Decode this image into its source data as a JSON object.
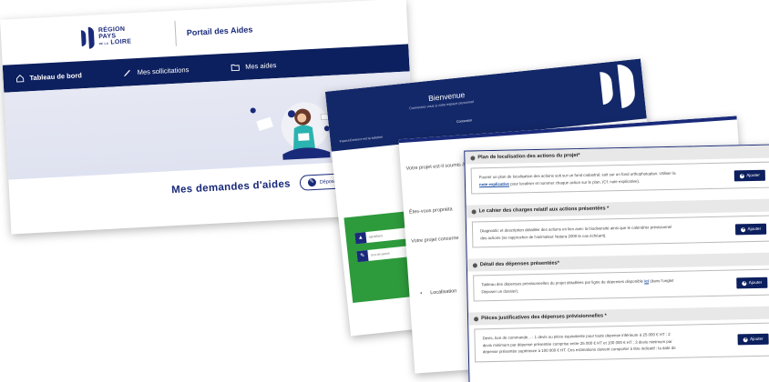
{
  "card1": {
    "logo": {
      "line1": "RÉGION",
      "line2": "PAYS",
      "line3": "LOIRE",
      "small": "DE LA"
    },
    "portal_title": "Portail des Aides",
    "nav": [
      {
        "label": "Tableau de bord",
        "icon": "home-icon"
      },
      {
        "label": "Mes sollicitations",
        "icon": "pen-icon"
      },
      {
        "label": "Mes aides",
        "icon": "folder-icon"
      }
    ],
    "heading": "Mes demandes d'aides",
    "deposit_button": "Déposer une de"
  },
  "card2": {
    "welcome": "Bienvenue",
    "subtitle": "Connectez-vous à votre espace personnel",
    "connexion": "Connexion",
    "franceconnect": "FranceConnect est la solution",
    "fields": [
      {
        "placeholder": "identifiant"
      },
      {
        "placeholder": "mot de passe"
      }
    ]
  },
  "card3": {
    "questions": [
      "Votre projet est-il soumis à",
      "Êtes-vous propriéta",
      "Votre projet concerne"
    ],
    "localisation": "Localisation"
  },
  "card4": {
    "sections": [
      {
        "title": "Plan de localisation des actions du projet*",
        "desc_before": "Fournir un plan de localisation des actions soit sur un fond cadastral, soit sur un fond orthophotoplan. Utiliser la ",
        "link": "note explicative",
        "desc_after": " pour localiser et nommer chaque action sur le plan. (Cf. note explicative).",
        "button": "Ajouter"
      },
      {
        "title": "Le cahier des charges relatif aux actions présentées *",
        "desc_before": "Diagnostic et description détaillée des actions en lien avec la biodiversité ainsi que le calendrier prévisionnel des actions (se rapprocher de l'animateur Natura 2000 le cas échéant).",
        "link": "",
        "desc_after": "",
        "button": "Ajouter"
      },
      {
        "title": "Détail des dépenses présentées*",
        "desc_before": "Tableau des dépenses prévisionnelles du projet détaillées par ligne de dépenses disponible ",
        "link": "ici",
        "desc_after": " (dans l'onglet Déposer un dossier).",
        "button": "Ajouter"
      },
      {
        "title": "Pièces justificatives des dépenses prévisionnelles *",
        "desc_before": "Devis, bon de commande... : 1 devis ou pièce équivalente pour toute dépense inférieure à 25 000 € HT ; 2 devis minimum par dépense présentée comprise entre 25 000 € HT et 100 000 € HT ; 3 devis minimum par dépense présentée supérieure à 100 000 € HT. Ces estimations doivent comporter à titre indicatif : la date de",
        "link": "",
        "desc_after": "",
        "button": "Ajouter"
      }
    ]
  },
  "colors": {
    "navy": "#0c1f5e",
    "green": "#2d9a3c",
    "hero": "#e3e6f2"
  }
}
